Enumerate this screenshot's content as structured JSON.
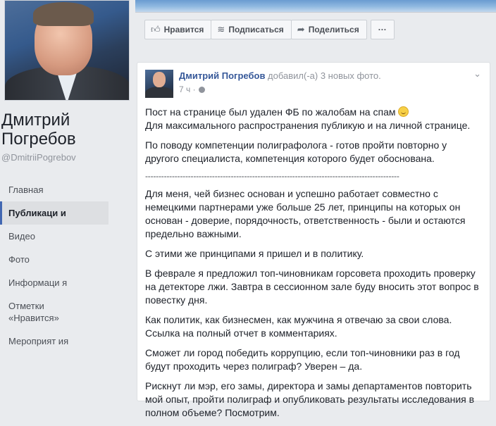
{
  "page": {
    "name_line1": "Дмитрий",
    "name_line2": "Погребов",
    "handle": "@DmitriiPogrebov"
  },
  "nav": {
    "items": [
      {
        "label": "Главная"
      },
      {
        "label": "Публикаци и"
      },
      {
        "label": "Видео"
      },
      {
        "label": "Фото"
      },
      {
        "label": "Информаци я"
      },
      {
        "label": "Отметки «Нравится»"
      },
      {
        "label": "Мероприят ия"
      }
    ],
    "active_index": 1
  },
  "actions": {
    "like_label": "Нравится",
    "like_icon": "thumbs-up-icon",
    "subscribe_label": "Подписаться",
    "subscribe_icon": "rss-icon",
    "share_label": "Поделиться",
    "share_icon": "share-arrow-icon",
    "more_label": "···"
  },
  "post": {
    "author": "Дмитрий Погребов",
    "action_text": " добавил(-а) 3 новых фото.",
    "time": "7 ч ·",
    "paragraphs": {
      "p1a": "Пост на странице был удален ФБ по жалобам на спам ",
      "p1b": "Для максимального распространения публикую и на личной странице.",
      "p2": "По поводу компетенции полиграфолога - готов пройти повторно у другого специалиста, компетенция которого будет обоснована.",
      "divider": "-----------------------------------------------------------------------------------------------",
      "p3": "Для меня, чей бизнес основан и успешно работает совместно с немецкими партнерами уже больше 25 лет, принципы на которых он основан - доверие, порядочность, ответственность - были и остаются предельно важными.",
      "p4": "С этими же принципами я пришел и в политику.",
      "p5": "В феврале я предложил топ-чиновникам горсовета проходить проверку на детекторе лжи. Завтра в сессионном зале буду вносить этот вопрос в повестку дня.",
      "p6": "Как политик, как бизнесмен, как мужчина я отвечаю за свои слова. Ссылка на полный отчет в комментариях.",
      "p7": "Сможет ли город победить коррупцию, если топ-чиновники раз в год будут проходить через полиграф? Уверен – да.",
      "p8": "Рискнут ли мэр, его замы, директора и замы департаментов повторить мой опыт, пройти полиграф и опубликовать результаты исследования в полном объеме? Посмотрим."
    }
  },
  "colors": {
    "link": "#365899",
    "muted": "#90949c",
    "background": "#e9ebee"
  }
}
